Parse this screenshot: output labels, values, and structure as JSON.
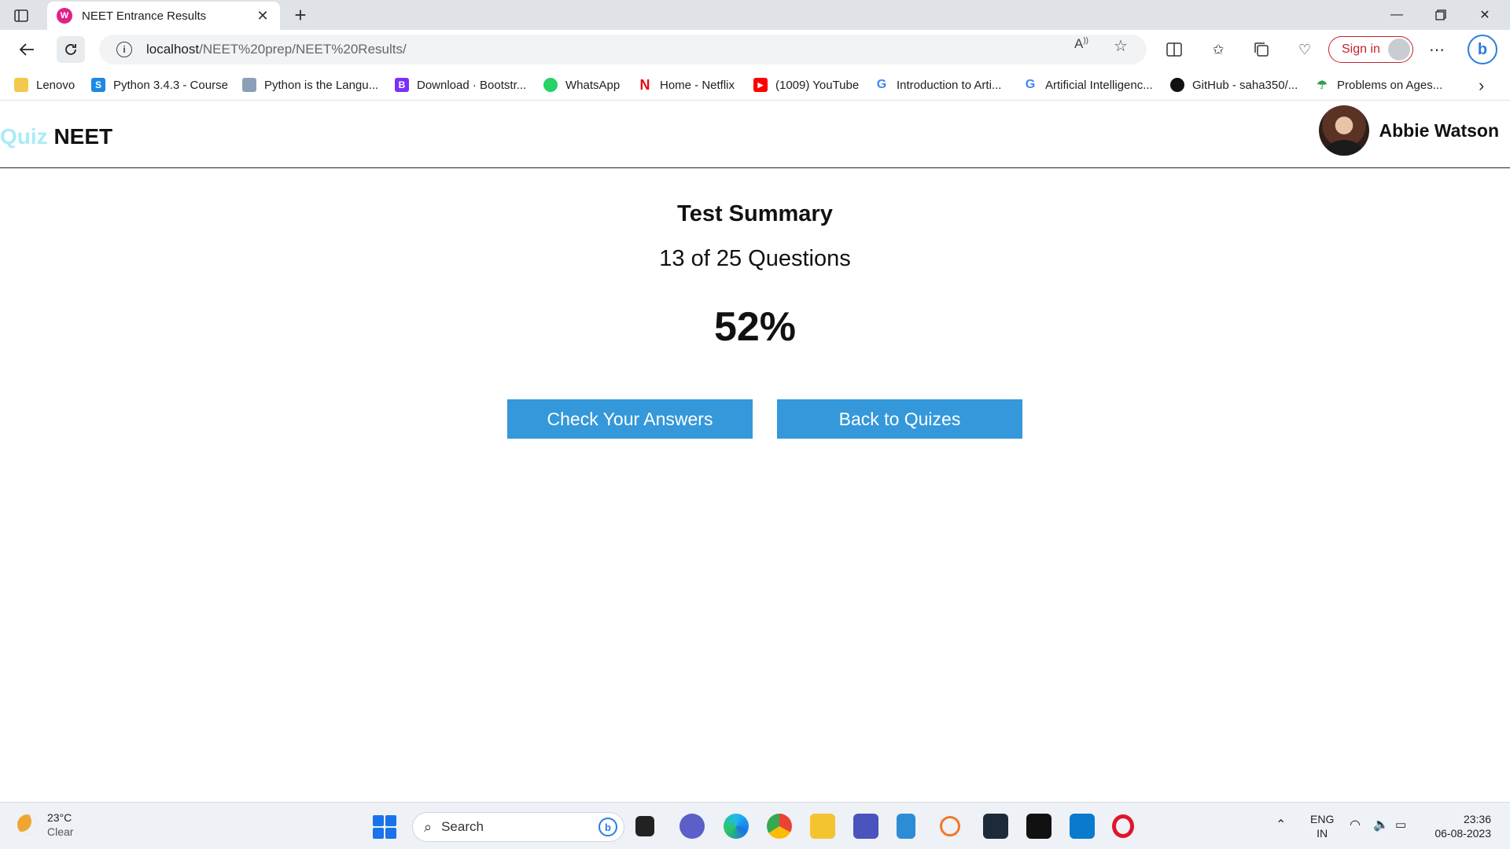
{
  "browser": {
    "tab_title": "NEET Entrance Results",
    "url_host": "localhost",
    "url_path": "/NEET%20prep/NEET%20Results/",
    "sign_in_label": "Sign in"
  },
  "bookmarks": [
    {
      "label": "Lenovo",
      "icon": "folder-icon",
      "color": "#f2c94c"
    },
    {
      "label": "Python 3.4.3 - Course",
      "icon": "python-s-icon",
      "color": "#1e88e5"
    },
    {
      "label": "Python is the Langu...",
      "icon": "python-icon",
      "color": "#8aa0b8"
    },
    {
      "label": "Download · Bootstr...",
      "icon": "bootstrap-icon",
      "color": "#7b2ff7"
    },
    {
      "label": "WhatsApp",
      "icon": "whatsapp-icon",
      "color": "#25d366"
    },
    {
      "label": "Home - Netflix",
      "icon": "netflix-icon",
      "color": "#e50914"
    },
    {
      "label": "(1009) YouTube",
      "icon": "youtube-icon",
      "color": "#ff0000"
    },
    {
      "label": "Introduction to Arti...",
      "icon": "google-icon",
      "color": "#4285f4"
    },
    {
      "label": "Artificial Intelligenc...",
      "icon": "google-icon",
      "color": "#4285f4"
    },
    {
      "label": "GitHub - saha350/...",
      "icon": "github-icon",
      "color": "#111111"
    },
    {
      "label": "Problems on Ages...",
      "icon": "leaf-icon",
      "color": "#2e9e4f"
    }
  ],
  "site": {
    "brand_quiz": "Quiz",
    "brand_neet": "NEET",
    "user_name": "Abbie Watson"
  },
  "summary": {
    "heading": "Test Summary",
    "count": "13 of 25 Questions",
    "percent": "52%"
  },
  "actions": {
    "check_label": "Check Your Answers",
    "back_label": "Back to Quizes"
  },
  "taskbar": {
    "temperature": "23°C",
    "condition": "Clear",
    "search_placeholder": "Search",
    "lang": "ENG",
    "region": "IN",
    "time": "23:36",
    "date": "06-08-2023"
  },
  "colors": {
    "button": "#3498db",
    "brand_quiz": "#a9ecf4"
  }
}
